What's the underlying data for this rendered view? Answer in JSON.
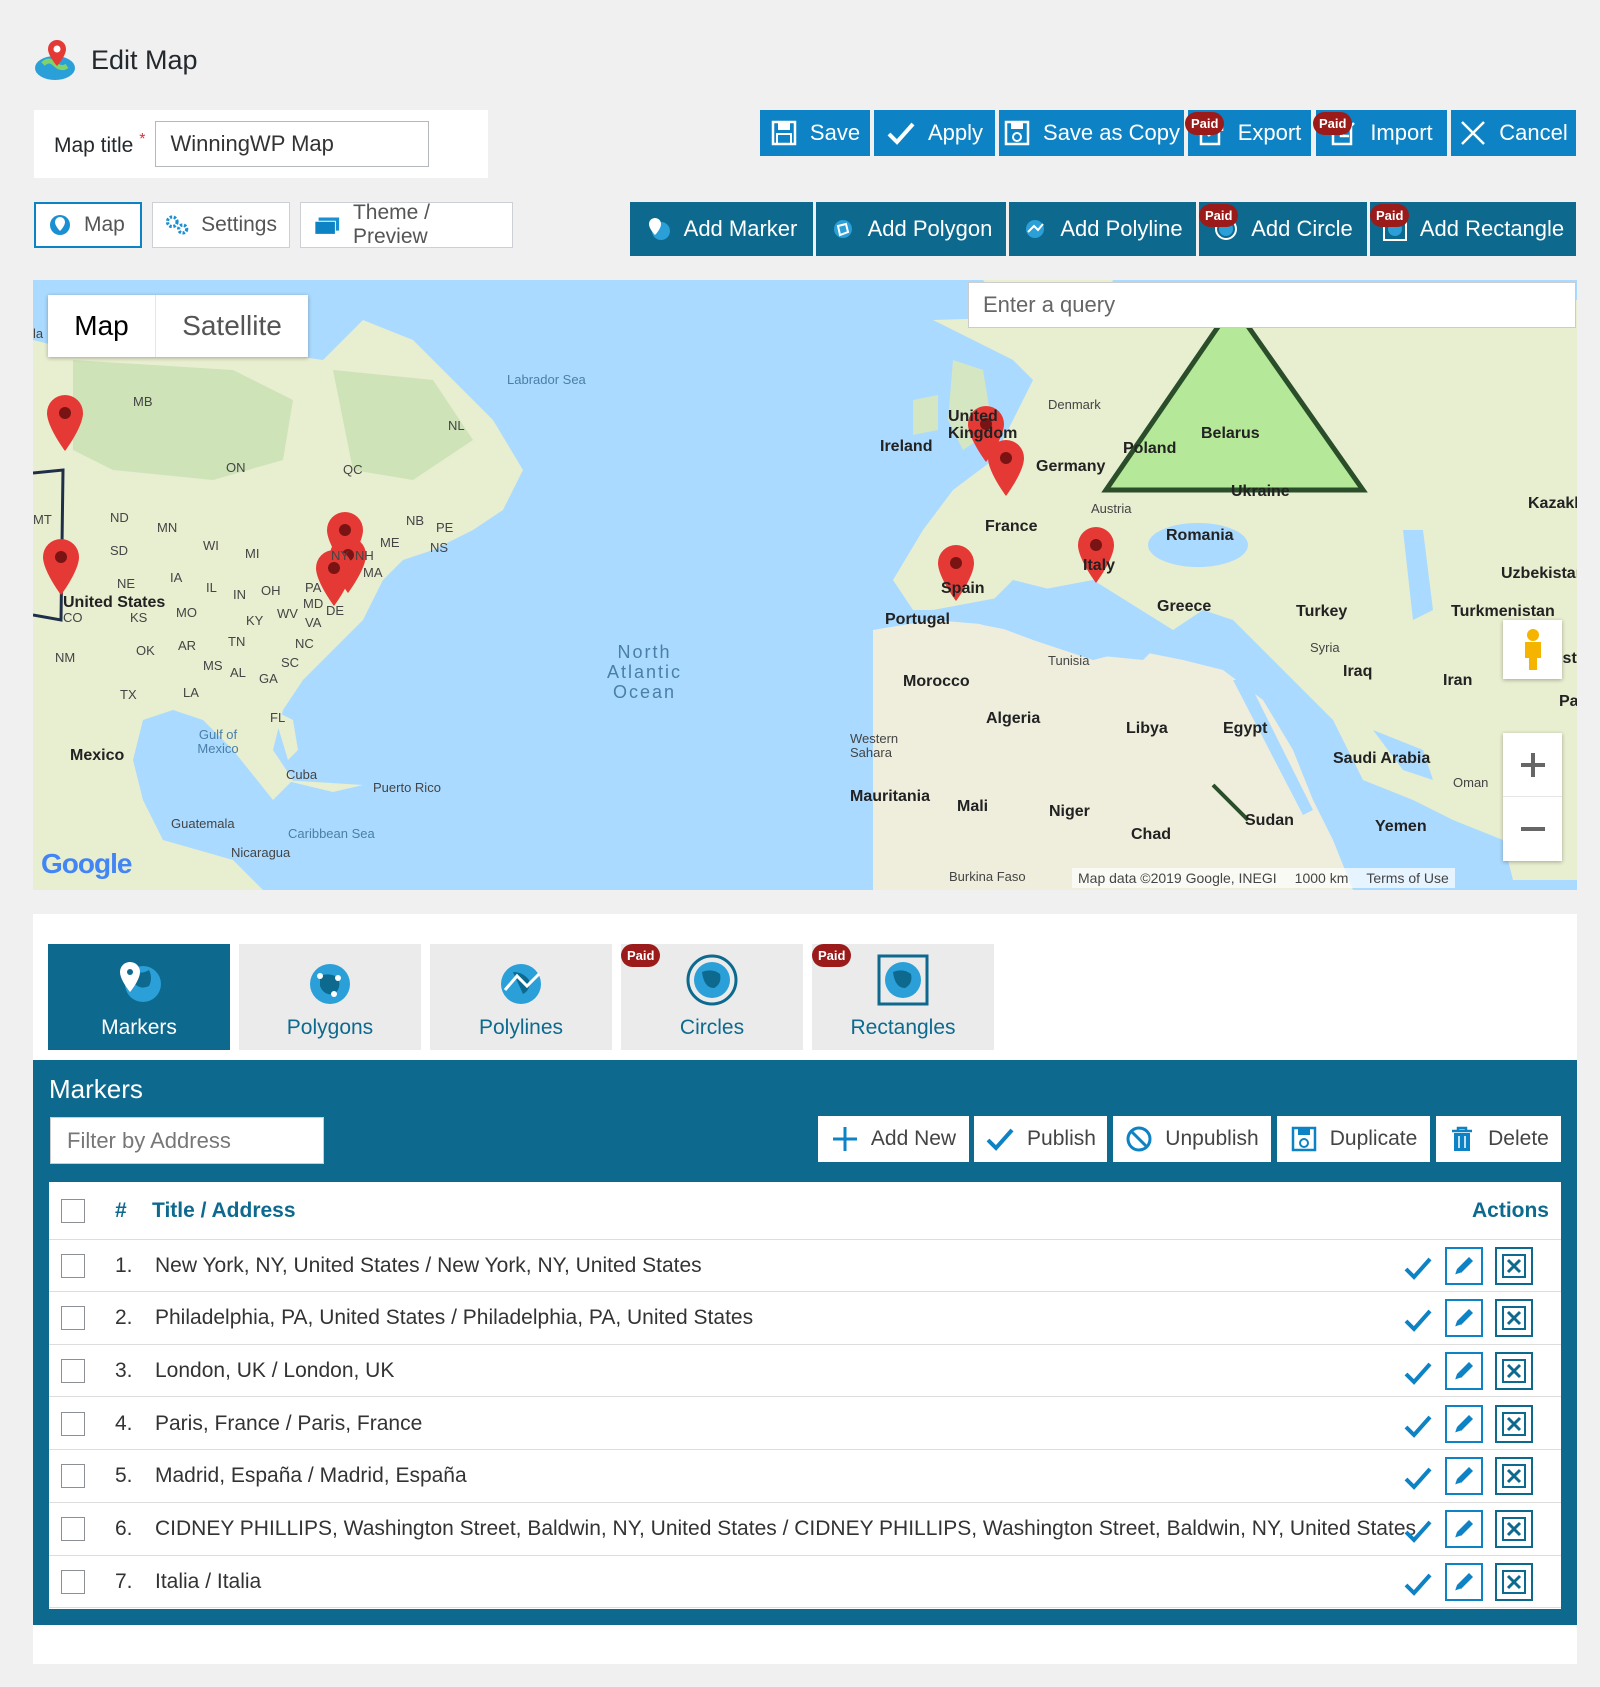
{
  "header": {
    "title": "Edit Map"
  },
  "map_title": {
    "label": "Map title",
    "required_mark": "*",
    "value": "WinningWP Map"
  },
  "top_actions": [
    {
      "label": "Save",
      "icon": "save-icon",
      "paid": ""
    },
    {
      "label": "Apply",
      "icon": "check-icon",
      "paid": ""
    },
    {
      "label": "Save as Copy",
      "icon": "save-copy-icon",
      "paid": ""
    },
    {
      "label": "Export",
      "icon": "export-icon",
      "paid": "Paid"
    },
    {
      "label": "Import",
      "icon": "import-icon",
      "paid": "Paid"
    },
    {
      "label": "Cancel",
      "icon": "close-icon",
      "paid": ""
    }
  ],
  "view_tabs": [
    {
      "label": "Map",
      "icon": "map-pin-icon",
      "active": true
    },
    {
      "label": "Settings",
      "icon": "gears-icon",
      "active": false
    },
    {
      "label": "Theme / Preview",
      "icon": "theme-icon",
      "active": false
    }
  ],
  "shape_actions": [
    {
      "label": "Add Marker",
      "icon": "marker-globe-icon",
      "paid": ""
    },
    {
      "label": "Add Polygon",
      "icon": "polygon-globe-icon",
      "paid": ""
    },
    {
      "label": "Add Polyline",
      "icon": "polyline-globe-icon",
      "paid": ""
    },
    {
      "label": "Add Circle",
      "icon": "circle-globe-icon",
      "paid": "Paid"
    },
    {
      "label": "Add Rectangle",
      "icon": "rectangle-globe-icon",
      "paid": "Paid"
    }
  ],
  "map": {
    "type_buttons": [
      "Map",
      "Satellite"
    ],
    "search_placeholder": "Enter a query",
    "footer": {
      "attribution": "Map data ©2019 Google, INEGI",
      "scale": "1000 km",
      "terms": "Terms of Use"
    },
    "google": "Google",
    "labels": {
      "labrador": "Labrador Sea",
      "ocean1": "North",
      "ocean2": "Atlantic",
      "ocean3": "Ocean",
      "ireland": "Ireland",
      "uk": "United Kingdom",
      "denmark": "Denmark",
      "poland": "Poland",
      "belarus": "Belarus",
      "ukraine": "Ukraine",
      "germany": "Germany",
      "austria": "Austria",
      "france": "France",
      "romania": "Romania",
      "spain": "Spain",
      "italy": "Italy",
      "portugal": "Portugal",
      "greece": "Greece",
      "turkey": "Turkey",
      "syria": "Syria",
      "iraq": "Iraq",
      "iran": "Iran",
      "tunisia": "Tunisia",
      "morocco": "Morocco",
      "algeria": "Algeria",
      "libya": "Libya",
      "egypt": "Egypt",
      "saudi": "Saudi Arabia",
      "oman": "Oman",
      "yemen": "Yemen",
      "wsahara": "Western Sahara",
      "mauritania": "Mauritania",
      "mali": "Mali",
      "niger": "Niger",
      "chad": "Chad",
      "sudan": "Sudan",
      "burkina": "Burkina Faso",
      "kazak": "Kazakh",
      "uzbek": "Uzbekistan",
      "turkm": "Turkmenistan",
      "afgh": "Afghanistan",
      "pak": "Pa",
      "us": "United States",
      "mexico": "Mexico",
      "gulf": "Gulf of Mexico",
      "cuba": "Cuba",
      "puerto": "Puerto Rico",
      "guatemala": "Guatemala",
      "nicaragua": "Nicaragua",
      "carib": "Caribbean Sea",
      "on": "ON",
      "qc": "QC",
      "nl": "NL",
      "mb": "MB",
      "nd": "ND",
      "sd": "SD",
      "ne": "NE",
      "ks": "KS",
      "ok": "OK",
      "tx": "TX",
      "mn": "MN",
      "wi": "WI",
      "mi": "MI",
      "ia": "IA",
      "il": "IL",
      "in": "IN",
      "oh": "OH",
      "pa": "PA",
      "ny": "NY",
      "me": "ME",
      "nb": "NB",
      "pe": "PE",
      "ns": "NS",
      "ma": "MA",
      "md": "MD",
      "de": "DE",
      "va": "VA",
      "wv": "WV",
      "ky": "KY",
      "tn": "TN",
      "nc": "NC",
      "sc": "SC",
      "ga": "GA",
      "al": "AL",
      "ms": "MS",
      "ar": "AR",
      "la": "LA",
      "mo": "MO",
      "fl": "FL",
      "nm": "NM",
      "co": "CO",
      "mt": "MT",
      "nh": "NH",
      "lab": "la"
    }
  },
  "object_tabs": [
    {
      "label": "Markers",
      "icon": "marker-globe-icon",
      "paid": "",
      "active": true
    },
    {
      "label": "Polygons",
      "icon": "polygon-globe-icon",
      "paid": "",
      "active": false
    },
    {
      "label": "Polylines",
      "icon": "polyline-globe-icon",
      "paid": "",
      "active": false
    },
    {
      "label": "Circles",
      "icon": "circle-globe-icon",
      "paid": "Paid",
      "active": false
    },
    {
      "label": "Rectangles",
      "icon": "rectangle-globe-icon",
      "paid": "Paid",
      "active": false
    }
  ],
  "markers_panel": {
    "title": "Markers",
    "filter_placeholder": "Filter by Address",
    "actions": [
      {
        "label": "Add New",
        "icon": "plus-icon"
      },
      {
        "label": "Publish",
        "icon": "check-icon"
      },
      {
        "label": "Unpublish",
        "icon": "ban-icon"
      },
      {
        "label": "Duplicate",
        "icon": "duplicate-icon"
      },
      {
        "label": "Delete",
        "icon": "trash-icon"
      }
    ],
    "columns": {
      "num": "#",
      "title": "Title / Address",
      "actions": "Actions"
    },
    "rows": [
      {
        "num": "1.",
        "title": "New York, NY, United States / New York, NY, United States"
      },
      {
        "num": "2.",
        "title": "Philadelphia, PA, United States / Philadelphia, PA, United States"
      },
      {
        "num": "3.",
        "title": "London, UK / London, UK"
      },
      {
        "num": "4.",
        "title": "Paris, France / Paris, France"
      },
      {
        "num": "5.",
        "title": "Madrid, España / Madrid, España"
      },
      {
        "num": "6.",
        "title": "CIDNEY PHILLIPS, Washington Street, Baldwin, NY, United States / CIDNEY PHILLIPS, Washington Street, Baldwin, NY, United States"
      },
      {
        "num": "7.",
        "title": "Italia / Italia"
      }
    ]
  },
  "colors": {
    "primary": "#0d82c4",
    "dark": "#0d6a8e",
    "paid": "#9b1b1b",
    "marker": "#e53935",
    "polygon": "#8be36a"
  }
}
